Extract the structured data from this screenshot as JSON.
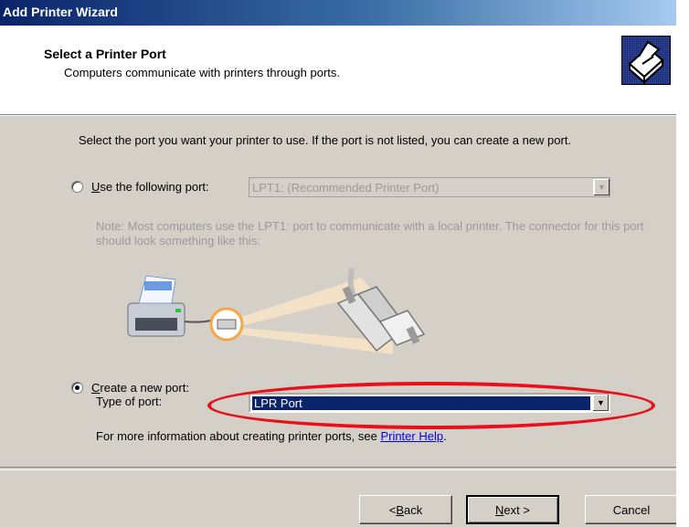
{
  "window": {
    "title": "Add Printer Wizard"
  },
  "header": {
    "title": "Select a Printer Port",
    "subtitle": "Computers communicate with printers through ports."
  },
  "main": {
    "instruction": "Select the port you want your printer to use.  If the port is not listed, you can create a new port.",
    "use_port": {
      "label_underlined": "U",
      "label_rest": "se the following port:",
      "selected": false,
      "select_value": "LPT1: (Recommended Printer Port)"
    },
    "note": "Note: Most computers use the LPT1: port to communicate with a local printer. The connector for this port should look something like this:",
    "create_port": {
      "label_underlined": "C",
      "label_rest": "reate a new port:",
      "selected": true,
      "type_label": "Type of port:",
      "select_value": "LPR Port"
    },
    "more_info": {
      "text": "For more information about creating printer ports, see ",
      "link": "Printer Help",
      "suffix": "."
    }
  },
  "buttons": {
    "back": {
      "prefix": "< ",
      "underlined": "B",
      "rest": "ack"
    },
    "next": {
      "underlined": "N",
      "rest": "ext >"
    },
    "cancel": {
      "label": "Cancel"
    }
  },
  "annotation": {
    "color": "#e8101a"
  },
  "colors": {
    "titlebar": "#0a246a",
    "dialog_face": "#d4d0c8",
    "selection": "#0a246a"
  }
}
